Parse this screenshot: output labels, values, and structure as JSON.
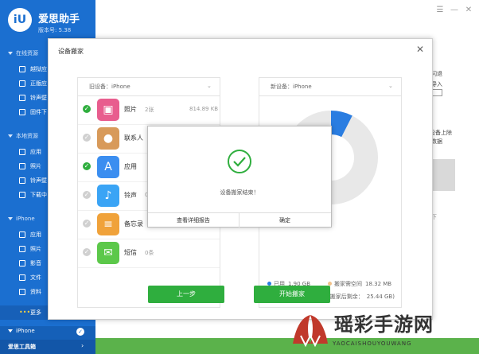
{
  "app": {
    "logo_glyph": "iU",
    "name": "爱思助手",
    "version": "版本号: 5.38"
  },
  "sidebar": {
    "sections": [
      {
        "label": "在线资源"
      },
      {
        "label": "本地资源"
      },
      {
        "label": "iPhone"
      }
    ],
    "online_items": [
      {
        "label": "越狱应"
      },
      {
        "label": "正版应"
      },
      {
        "label": "铃声壁"
      },
      {
        "label": "固件下"
      }
    ],
    "local_items": [
      {
        "label": "应用"
      },
      {
        "label": "照片"
      },
      {
        "label": "铃声壁"
      },
      {
        "label": "下载中"
      }
    ],
    "iphone_items": [
      {
        "label": "应用"
      },
      {
        "label": "照片"
      },
      {
        "label": "影音"
      },
      {
        "label": "文件"
      },
      {
        "label": "资料"
      },
      {
        "label": "更多"
      }
    ],
    "bottom_device": "iPhone",
    "toolbox": "爱思工具箱"
  },
  "window_controls": {
    "menu": "☰",
    "minimize": "—",
    "close": "✕"
  },
  "dialog": {
    "title": "设备搬家",
    "close_glyph": "✕",
    "old_device_label": "旧设备：iPhone",
    "new_device_label": "新设备：iPhone",
    "rows": [
      {
        "name": "照片",
        "count": "2张",
        "size": "814.89 KB",
        "checked": true,
        "color": "#e85d8e",
        "glyph": "▣"
      },
      {
        "name": "联系人",
        "count": "0",
        "size": "",
        "checked": false,
        "color": "#d89a5a",
        "glyph": "●"
      },
      {
        "name": "应用",
        "count": "",
        "size": "",
        "checked": true,
        "color": "#3b8ef0",
        "glyph": "A"
      },
      {
        "name": "铃声",
        "count": "0",
        "size": "",
        "checked": false,
        "color": "#3aa4f5",
        "glyph": "♪"
      },
      {
        "name": "备忘录",
        "count": "",
        "size": "",
        "checked": false,
        "color": "#f0a23a",
        "glyph": "≡"
      },
      {
        "name": "短信",
        "count": "0条",
        "size": "",
        "checked": false,
        "color": "#5cc84a",
        "glyph": "✉"
      }
    ],
    "prev_button": "上一步",
    "start_button": "开始搬家",
    "storage": {
      "used_fraction": 0.075,
      "used_color": "#2a7de1",
      "free_color": "#e8e8e8",
      "legend": [
        {
          "dot_color": "#2a7de1",
          "label": "已用",
          "value": "1.90 GB"
        },
        {
          "dot_color": "#f2c28a",
          "label": "搬家需空间",
          "value": "18.32 MB"
        },
        {
          "dot_color": "#cfcfcf",
          "label": "剩余",
          "value": "25.46 GB"
        },
        {
          "dot_color": "",
          "label": "(搬家后剩余：",
          "value": "25.44 GB)"
        }
      ]
    }
  },
  "popup": {
    "message": "设备搬家结束！",
    "detail_button": "查看详细报告",
    "ok_button": "确定"
  },
  "right_partial": {
    "line1": "闪退",
    "line2": "导入",
    "line3": "",
    "line4": "上除",
    "line5": "设备上除",
    "line6": "数据",
    "line7": "下"
  },
  "watermark": {
    "text": "瑶彩手游网",
    "sub": "YAOCAISHOUYOUWANG"
  }
}
